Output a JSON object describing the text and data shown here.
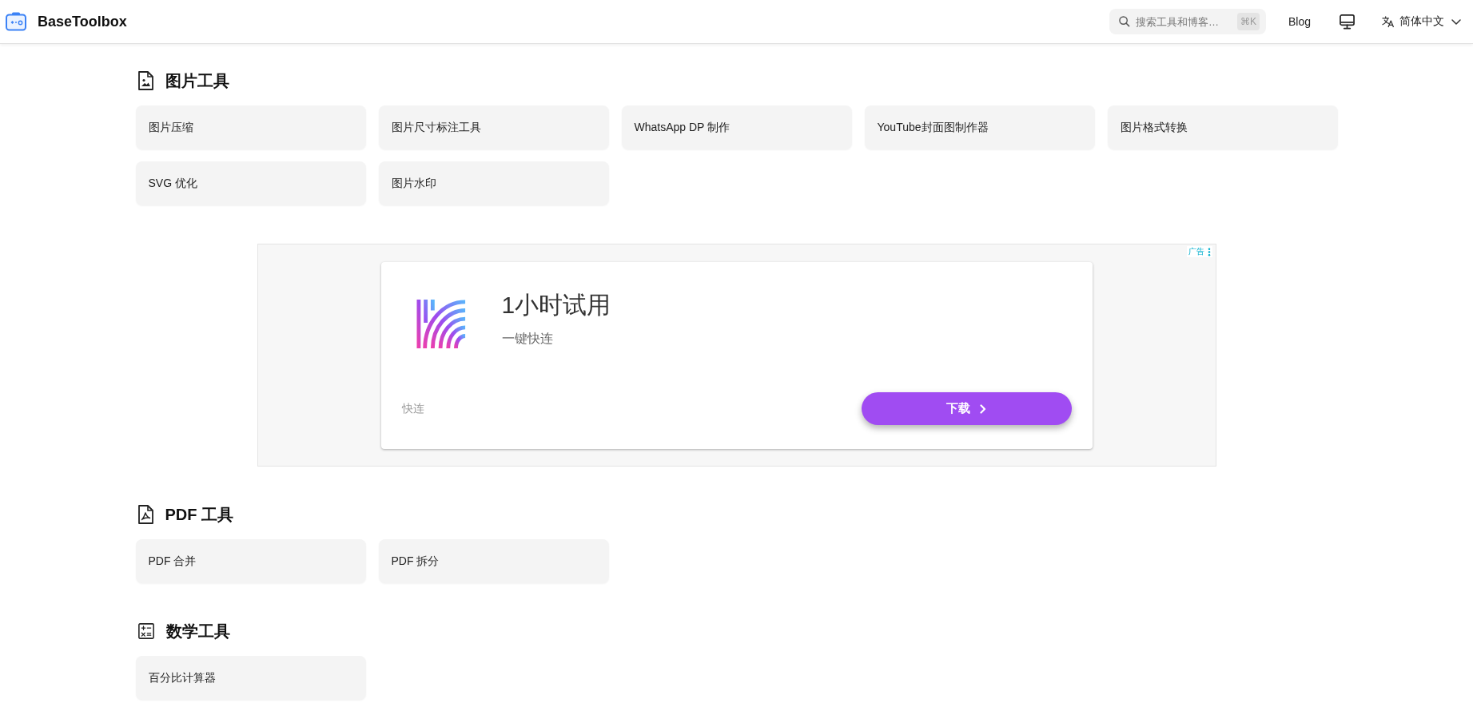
{
  "header": {
    "logo": "BaseToolbox",
    "search": {
      "placeholder": "搜索工具和博客…",
      "shortcut": "⌘K"
    },
    "nav": [
      {
        "label": "Blog"
      }
    ],
    "language": "简体中文"
  },
  "blocks": [
    {
      "kind": "tools",
      "title": "图片工具",
      "tools": [
        "图片压缩",
        "图片尺寸标注工具",
        "WhatsApp DP 制作",
        "YouTube封面图制作器",
        "图片格式转换",
        "SVG 优化",
        "图片水印"
      ]
    },
    {
      "kind": "ad",
      "label": "广告",
      "title": "1小时试用",
      "subtitle": "一键快连",
      "advertiser": "快连",
      "button": "下载"
    },
    {
      "kind": "tools",
      "title": "PDF 工具",
      "tools": [
        "PDF 合并",
        "PDF 拆分"
      ]
    },
    {
      "kind": "tools",
      "title": "数学工具",
      "tools": [
        "百分比计算器"
      ]
    }
  ]
}
